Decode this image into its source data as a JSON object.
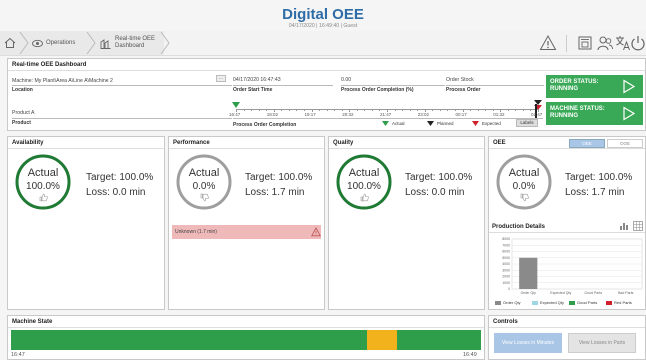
{
  "header": {
    "title": "Digital OEE",
    "subtitle": "04/17/2020 | 16:49:40 | Guest"
  },
  "nav": {
    "crumbs": [
      {
        "label": "Operations"
      },
      {
        "label_line1": "Real-time OEE",
        "label_line2": "Dashboard"
      }
    ],
    "icons": [
      "home-icon",
      "warning-icon",
      "report-icon",
      "users-icon",
      "language-icon",
      "power-icon"
    ]
  },
  "dashboard": {
    "title": "Real-time OEE Dashboard",
    "location": {
      "value": "Machine: My Plant\\Area A\\Line A\\Machine 2",
      "label": "Location"
    },
    "order_start": {
      "value": "04/17/2020 16:47:43",
      "label": "Order Start Time"
    },
    "completion": {
      "value": "0.00",
      "label": "Process Order Completion (%)"
    },
    "order": {
      "value": "Order Stock",
      "label": "Process Order"
    },
    "product": {
      "value": "Product A",
      "label": "Product"
    },
    "timeline": {
      "label": "Process Order Completion",
      "ticks": [
        "16:47",
        "18:02",
        "19:17",
        "20:32",
        "21:47",
        "23:02",
        "00:17",
        "01:32",
        "02:47"
      ],
      "legend": [
        {
          "label": "Actual",
          "color": "#2e9e4b"
        },
        {
          "label": "Planned",
          "color": "#222222"
        },
        {
          "label": "Expected",
          "color": "#d0202a"
        }
      ],
      "labels_btn": "Labels",
      "actual_progress": 0.0,
      "planned_progress": 1.0,
      "expected_progress": 1.0
    },
    "order_status": {
      "line1": "ORDER STATUS:",
      "line2": "RUNNING",
      "color": "#3aa957"
    },
    "machine_status": {
      "line1": "MACHINE STATUS:",
      "line2": "RUNNING",
      "color": "#3aa957"
    }
  },
  "kpis": {
    "availability": {
      "title": "Availability",
      "actual_label": "Actual",
      "actual": "100.0%",
      "actual_fraction": 1.0,
      "target": "Target: 100.0%",
      "loss": "Loss: 0.0 min",
      "ring_color": "#1f7a34"
    },
    "performance": {
      "title": "Performance",
      "actual_label": "Actual",
      "actual": "0.0%",
      "actual_fraction": 0.0,
      "target": "Target: 100.0%",
      "loss": "Loss: 1.7 min",
      "ring_color": "#9e9e9e",
      "alert_text": "Unknown (1.7 min)",
      "alert_color": "#f0b9b9"
    },
    "quality": {
      "title": "Quality",
      "actual_label": "Actual",
      "actual": "100.0%",
      "actual_fraction": 1.0,
      "target": "Target: 100.0%",
      "loss": "Loss: 0.0 min",
      "ring_color": "#1f7a34"
    },
    "oee": {
      "title": "OEE",
      "toggle": [
        "OEE",
        "OOE"
      ],
      "actual_label": "Actual",
      "actual": "0.0%",
      "actual_fraction": 0.0,
      "target": "Target: 100.0%",
      "loss": "Loss: 1.7 min",
      "ring_color": "#9e9e9e"
    }
  },
  "production": {
    "title": "Production Details",
    "chart_data": {
      "type": "bar",
      "categories": [
        "Order Qty",
        "Expected Qty",
        "Good Parts",
        "Bad Parts"
      ],
      "values": [
        5000,
        0,
        0,
        0
      ],
      "ylim": [
        0,
        8000
      ],
      "y_ticks": [
        "8000",
        "7000",
        "6000",
        "5000",
        "4000",
        "3000",
        "2000",
        "1000",
        "0"
      ],
      "series_colors": [
        "#8a8a8a",
        "#9fd6e3",
        "#2e9e4b",
        "#d0202a"
      ],
      "legend": [
        "Order Qty",
        "Expected Qty",
        "Good Parts",
        "Red Parts"
      ],
      "grid": true
    }
  },
  "machine_state": {
    "title": "Machine State",
    "start": "16:47",
    "end": "16:49",
    "segments": [
      {
        "state": "running",
        "color": "#2e9e4b",
        "fraction": 0.757
      },
      {
        "state": "warning",
        "color": "#f2b21c",
        "fraction": 0.064
      },
      {
        "state": "running",
        "color": "#2e9e4b",
        "fraction": 0.179
      }
    ]
  },
  "controls": {
    "title": "Controls",
    "btn_minutes": "View Losses in Minutes",
    "btn_parts": "View Losses in Parts"
  }
}
